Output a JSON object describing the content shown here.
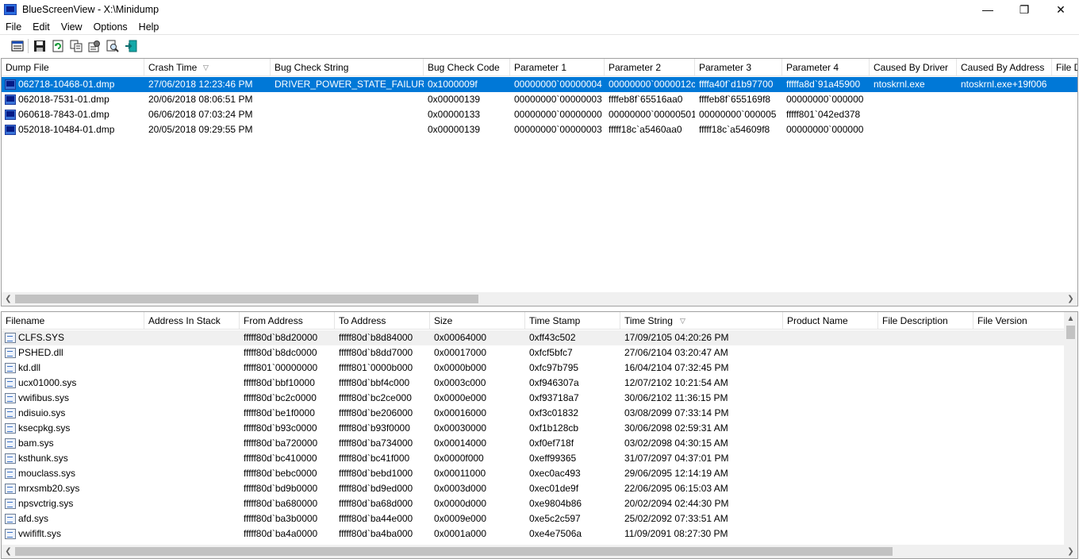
{
  "window": {
    "title": "BlueScreenView  -  X:\\Minidump",
    "minimize": "—",
    "maximize": "❐",
    "close": "✕"
  },
  "menu": [
    "File",
    "Edit",
    "View",
    "Options",
    "Help"
  ],
  "toolbar": [
    {
      "icon": "properties-window-icon"
    },
    {
      "icon": "save-icon"
    },
    {
      "icon": "refresh-icon"
    },
    {
      "icon": "copy-icon"
    },
    {
      "icon": "advanced-options-icon"
    },
    {
      "icon": "find-icon"
    },
    {
      "icon": "exit-icon"
    }
  ],
  "dumps": {
    "columns": [
      "Dump File",
      "Crash Time",
      "Bug Check String",
      "Bug Check Code",
      "Parameter 1",
      "Parameter 2",
      "Parameter 3",
      "Parameter 4",
      "Caused By Driver",
      "Caused By Address",
      "File D"
    ],
    "sorted_column_index": 1,
    "rows": [
      [
        "062718-10468-01.dmp",
        "27/06/2018 12:23:46 PM",
        "DRIVER_POWER_STATE_FAILURE",
        "0x1000009f",
        "00000000`00000004",
        "00000000`0000012c",
        "ffffa40f`d1b97700",
        "fffffa8d`91a45900",
        "ntoskrnl.exe",
        "ntoskrnl.exe+19f006",
        ""
      ],
      [
        "062018-7531-01.dmp",
        "20/06/2018 08:06:51 PM",
        "",
        "0x00000139",
        "00000000`00000003",
        "ffffeb8f`65516aa0",
        "ffffeb8f`655169f8",
        "00000000`000000",
        "",
        "",
        ""
      ],
      [
        "060618-7843-01.dmp",
        "06/06/2018 07:03:24 PM",
        "",
        "0x00000133",
        "00000000`00000000",
        "00000000`00000501",
        "00000000`000005",
        "fffff801`042ed378",
        "",
        "",
        ""
      ],
      [
        "052018-10484-01.dmp",
        "20/05/2018 09:29:55 PM",
        "",
        "0x00000139",
        "00000000`00000003",
        "fffff18c`a5460aa0",
        "fffff18c`a54609f8",
        "00000000`000000",
        "",
        "",
        ""
      ]
    ]
  },
  "drivers": {
    "columns": [
      "Filename",
      "Address In Stack",
      "From Address",
      "To Address",
      "Size",
      "Time Stamp",
      "Time String",
      "Product Name",
      "File Description",
      "File Version"
    ],
    "sorted_column_index": 6,
    "rows": [
      [
        "CLFS.SYS",
        "",
        "fffff80d`b8d20000",
        "fffff80d`b8d84000",
        "0x00064000",
        "0xff43c502",
        "17/09/2105 04:20:26 PM",
        "",
        "",
        ""
      ],
      [
        "PSHED.dll",
        "",
        "fffff80d`b8dc0000",
        "fffff80d`b8dd7000",
        "0x00017000",
        "0xfcf5bfc7",
        "27/06/2104 03:20:47 AM",
        "",
        "",
        ""
      ],
      [
        "kd.dll",
        "",
        "fffff801`00000000",
        "fffff801`0000b000",
        "0x0000b000",
        "0xfc97b795",
        "16/04/2104 07:32:45 PM",
        "",
        "",
        ""
      ],
      [
        "ucx01000.sys",
        "",
        "fffff80d`bbf10000",
        "fffff80d`bbf4c000",
        "0x0003c000",
        "0xf946307a",
        "12/07/2102 10:21:54 AM",
        "",
        "",
        ""
      ],
      [
        "vwifibus.sys",
        "",
        "fffff80d`bc2c0000",
        "fffff80d`bc2ce000",
        "0x0000e000",
        "0xf93718a7",
        "30/06/2102 11:36:15 PM",
        "",
        "",
        ""
      ],
      [
        "ndisuio.sys",
        "",
        "fffff80d`be1f0000",
        "fffff80d`be206000",
        "0x00016000",
        "0xf3c01832",
        "03/08/2099 07:33:14 PM",
        "",
        "",
        ""
      ],
      [
        "ksecpkg.sys",
        "",
        "fffff80d`b93c0000",
        "fffff80d`b93f0000",
        "0x00030000",
        "0xf1b128cb",
        "30/06/2098 02:59:31 AM",
        "",
        "",
        ""
      ],
      [
        "bam.sys",
        "",
        "fffff80d`ba720000",
        "fffff80d`ba734000",
        "0x00014000",
        "0xf0ef718f",
        "03/02/2098 04:30:15 AM",
        "",
        "",
        ""
      ],
      [
        "ksthunk.sys",
        "",
        "fffff80d`bc410000",
        "fffff80d`bc41f000",
        "0x0000f000",
        "0xeff99365",
        "31/07/2097 04:37:01 PM",
        "",
        "",
        ""
      ],
      [
        "mouclass.sys",
        "",
        "fffff80d`bebc0000",
        "fffff80d`bebd1000",
        "0x00011000",
        "0xec0ac493",
        "29/06/2095 12:14:19 AM",
        "",
        "",
        ""
      ],
      [
        "mrxsmb20.sys",
        "",
        "fffff80d`bd9b0000",
        "fffff80d`bd9ed000",
        "0x0003d000",
        "0xec01de9f",
        "22/06/2095 06:15:03 AM",
        "",
        "",
        ""
      ],
      [
        "npsvctrig.sys",
        "",
        "fffff80d`ba680000",
        "fffff80d`ba68d000",
        "0x0000d000",
        "0xe9804b86",
        "20/02/2094 02:44:30 PM",
        "",
        "",
        ""
      ],
      [
        "afd.sys",
        "",
        "fffff80d`ba3b0000",
        "fffff80d`ba44e000",
        "0x0009e000",
        "0xe5c2c597",
        "25/02/2092 07:33:51 AM",
        "",
        "",
        ""
      ],
      [
        "vwififlt.sys",
        "",
        "fffff80d`ba4a0000",
        "fffff80d`ba4ba000",
        "0x0001a000",
        "0xe4e7506a",
        "11/09/2091 08:27:30 PM",
        "",
        "",
        ""
      ]
    ]
  },
  "icons": {
    "dump_row": "blue-screen-icon",
    "driver_row": "driver-file-icon",
    "sort": "sort-descending-icon"
  },
  "colors": {
    "selection": "#0078d7",
    "title_bar_bg": "#ffffff"
  }
}
